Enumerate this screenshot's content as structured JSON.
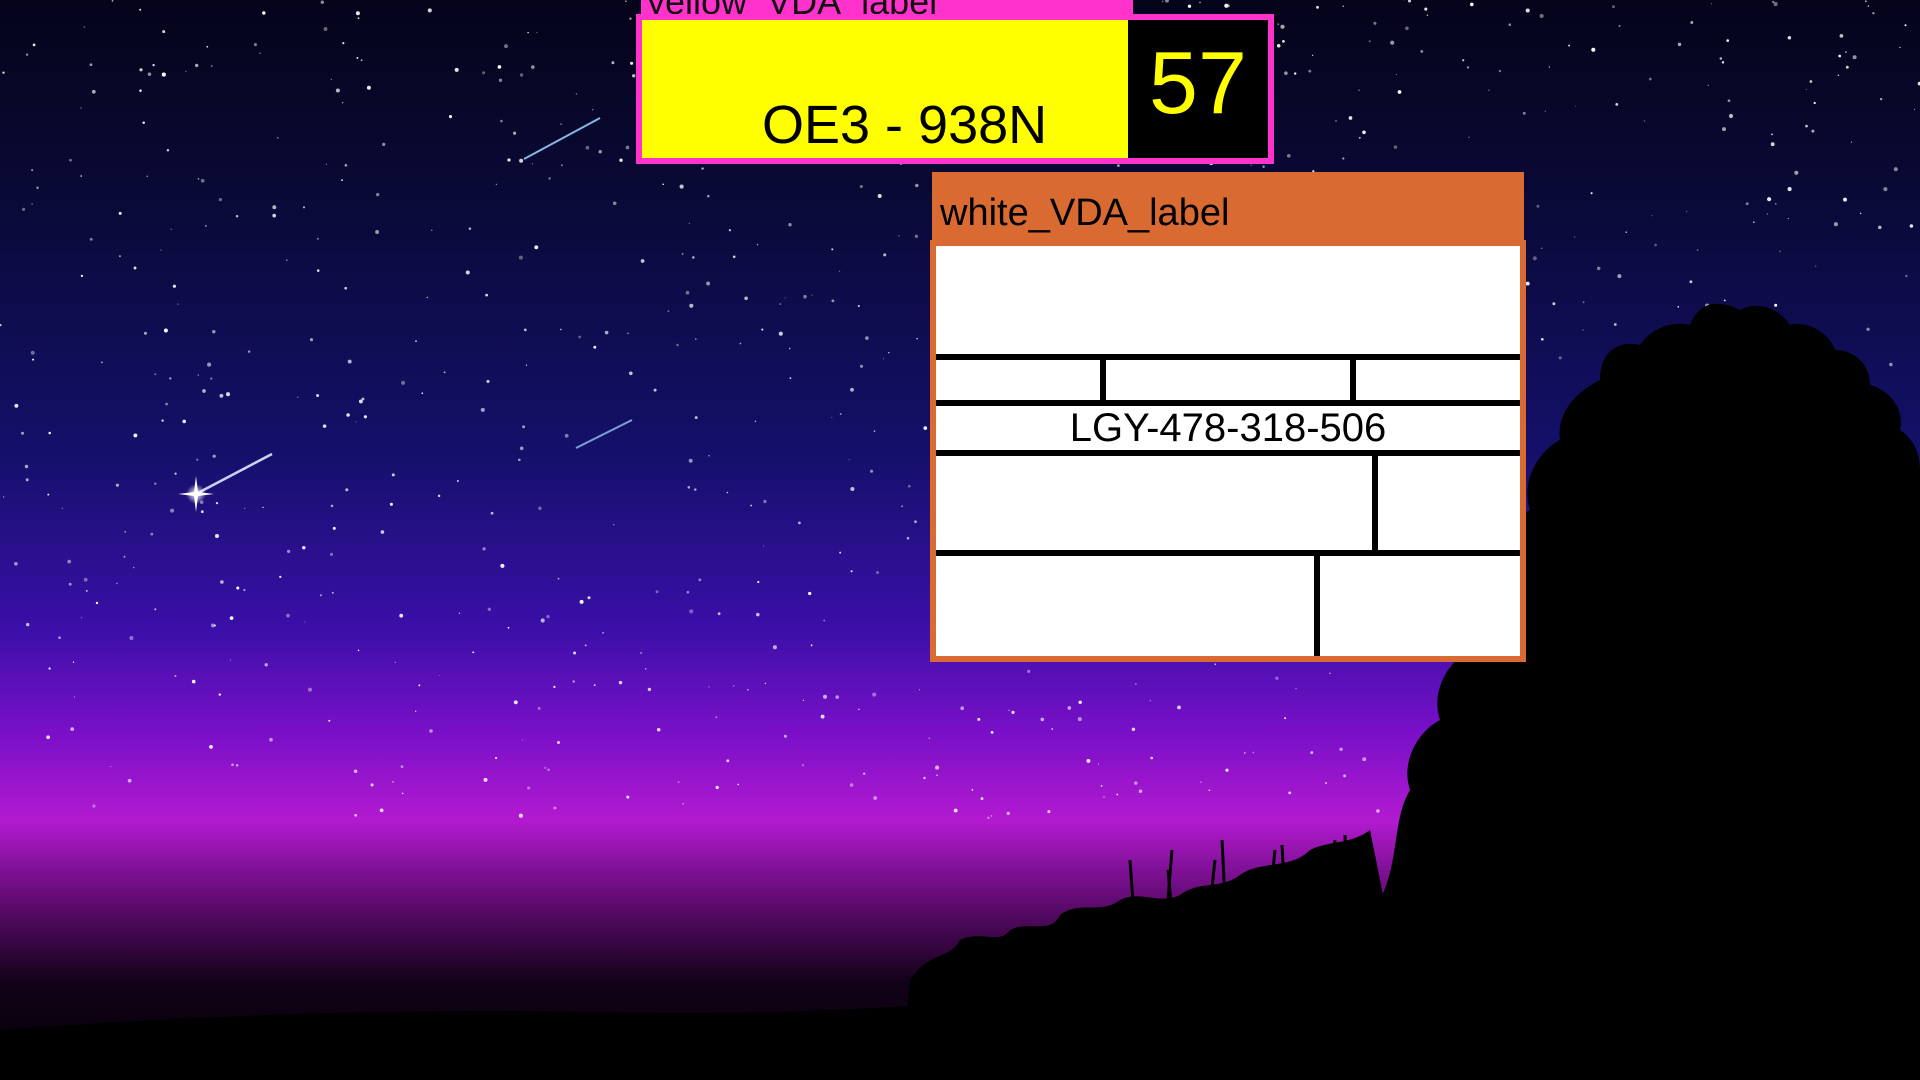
{
  "yellow_label": {
    "title": "yellow_VDA_label",
    "plate_text": "OE3 - 938N",
    "number": "57",
    "colors": {
      "border": "#ff33cc",
      "background": "#ffff00",
      "number_bg": "#000000",
      "number_fg": "#ffff00"
    }
  },
  "white_label": {
    "title": "white_VDA_label",
    "code": "LGY-478-318-506",
    "colors": {
      "border": "#d86a32",
      "background": "#ffffff"
    }
  }
}
